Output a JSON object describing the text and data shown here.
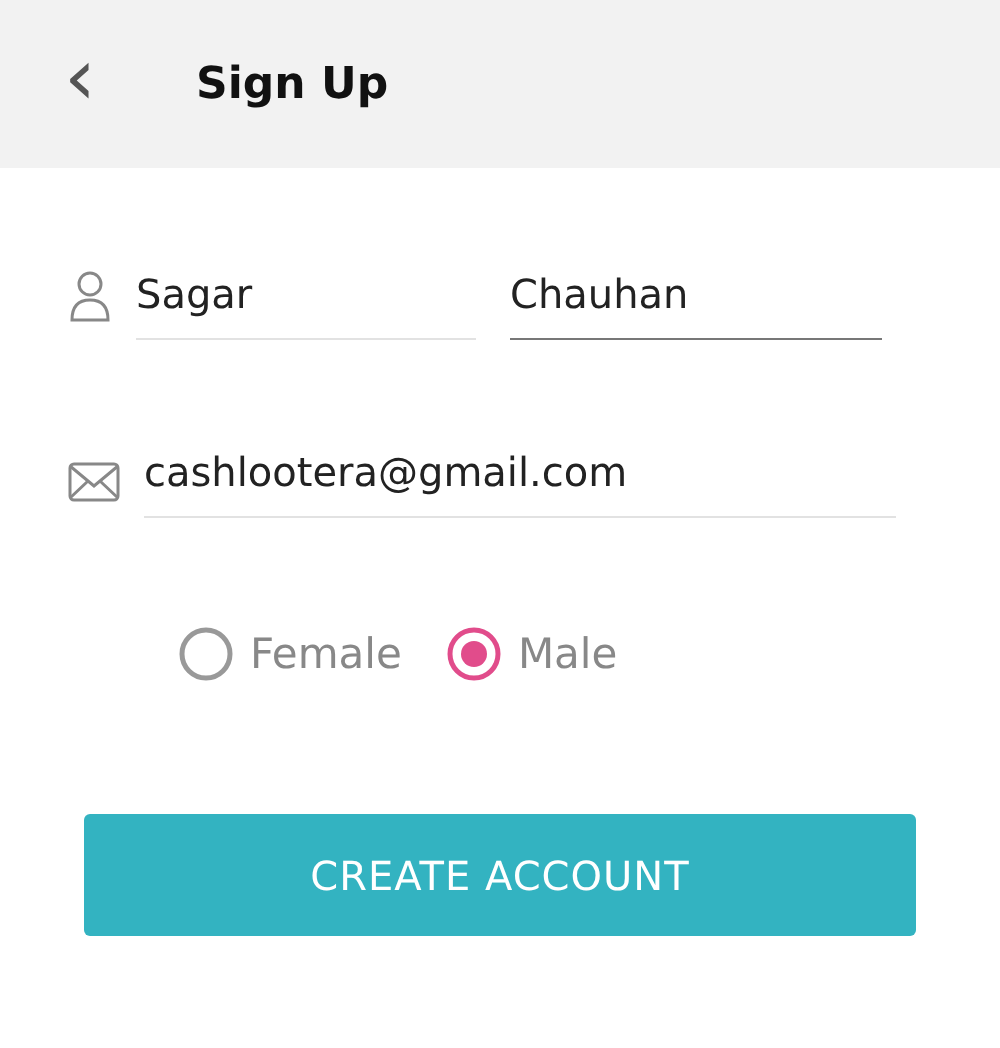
{
  "header": {
    "back": "‹",
    "title": "Sign Up"
  },
  "name_fields": [
    {
      "value": "Sagar",
      "focused": false
    },
    {
      "value": "Chauhan",
      "focused": true
    }
  ],
  "email_field": {
    "value": "cashlootera@gmail.com",
    "focused": false
  },
  "gender": [
    {
      "label": "Female",
      "selected": false
    },
    {
      "label": "Male",
      "selected": true
    }
  ],
  "submit": "CREATE ACCOUNT"
}
